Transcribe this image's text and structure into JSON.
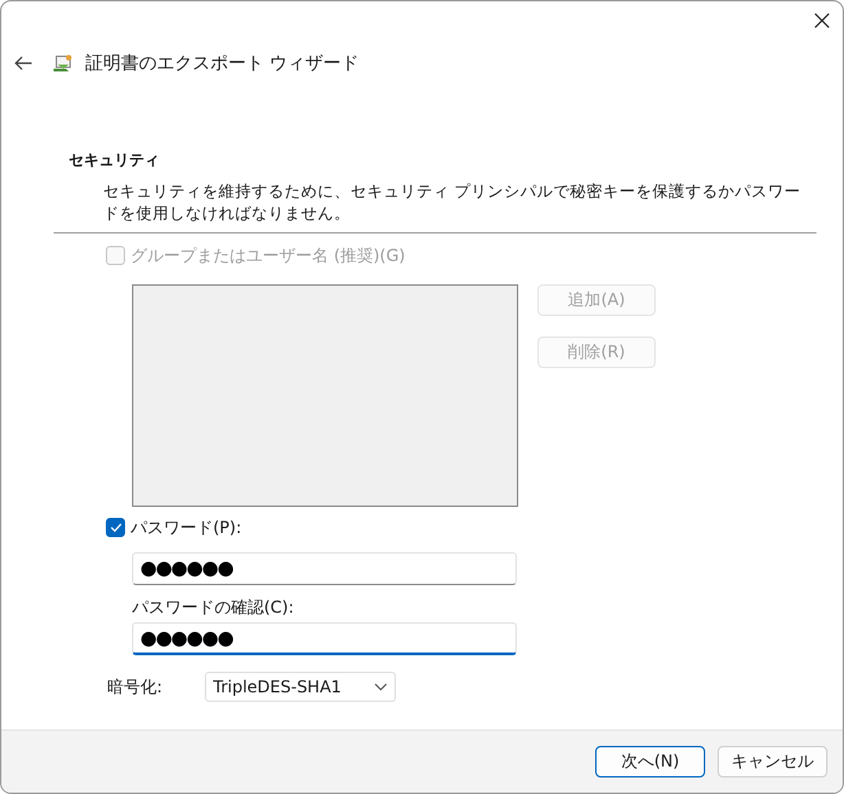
{
  "window": {
    "title": "証明書のエクスポート ウィザード"
  },
  "section": {
    "heading": "セキュリティ",
    "description": "セキュリティを維持するために、セキュリティ プリンシパルで秘密キーを保護するかパスワードを使用しなければなりません。"
  },
  "group_option": {
    "label": "グループまたはユーザー名 (推奨)(G)",
    "checked": false,
    "disabled": true
  },
  "group_buttons": [
    {
      "label": "追加(A)",
      "disabled": true
    },
    {
      "label": "削除(R)",
      "disabled": true
    }
  ],
  "password_option": {
    "label": "パスワード(P):",
    "checked": true,
    "disabled": false
  },
  "password": {
    "value": "●●●●●●",
    "focused": false
  },
  "confirm": {
    "label": "パスワードの確認(C):",
    "value": "●●●●●●",
    "focused": true
  },
  "encryption": {
    "label": "暗号化:",
    "value": "TripleDES-SHA1"
  },
  "buttons": [
    {
      "label": "次へ(N)",
      "default": true
    },
    {
      "label": "キャンセル",
      "default": false
    }
  ]
}
